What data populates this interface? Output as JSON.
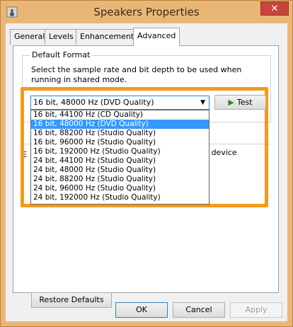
{
  "window": {
    "title": "Speakers Properties",
    "close_glyph": "✕",
    "icon": "speaker-icon"
  },
  "tabs": [
    {
      "label": "General"
    },
    {
      "label": "Levels"
    },
    {
      "label": "Enhancements"
    },
    {
      "label": "Advanced",
      "active": true
    }
  ],
  "default_format": {
    "title": "Default Format",
    "description": "Select the sample rate and bit depth to be used when running in shared mode.",
    "selected_value": "16 bit, 48000 Hz (DVD Quality)",
    "test_label": "Test",
    "options": [
      {
        "label": "16 bit, 44100 Hz (CD Quality)"
      },
      {
        "label": "16 bit, 48000 Hz (DVD Quality)",
        "selected": true
      },
      {
        "label": "16 bit, 88200 Hz (Studio Quality)"
      },
      {
        "label": "16 bit, 96000 Hz (Studio Quality)"
      },
      {
        "label": "16 bit, 192000 Hz (Studio Quality)"
      },
      {
        "label": "24 bit, 44100 Hz (Studio Quality)"
      },
      {
        "label": "24 bit, 48000 Hz (Studio Quality)"
      },
      {
        "label": "24 bit, 88200 Hz (Studio Quality)"
      },
      {
        "label": "24 bit, 96000 Hz (Studio Quality)"
      },
      {
        "label": "24 bit, 192000 Hz (Studio Quality)"
      }
    ]
  },
  "exclusive": {
    "fragment": "E",
    "tail_text": "this device"
  },
  "restore_label": "Restore Defaults",
  "buttons": {
    "ok": "OK",
    "cancel": "Cancel",
    "apply": "Apply"
  },
  "colors": {
    "highlight": "#f49a1b",
    "selection": "#3399ff",
    "titlebar": "#eab676",
    "close": "#c7463b"
  }
}
